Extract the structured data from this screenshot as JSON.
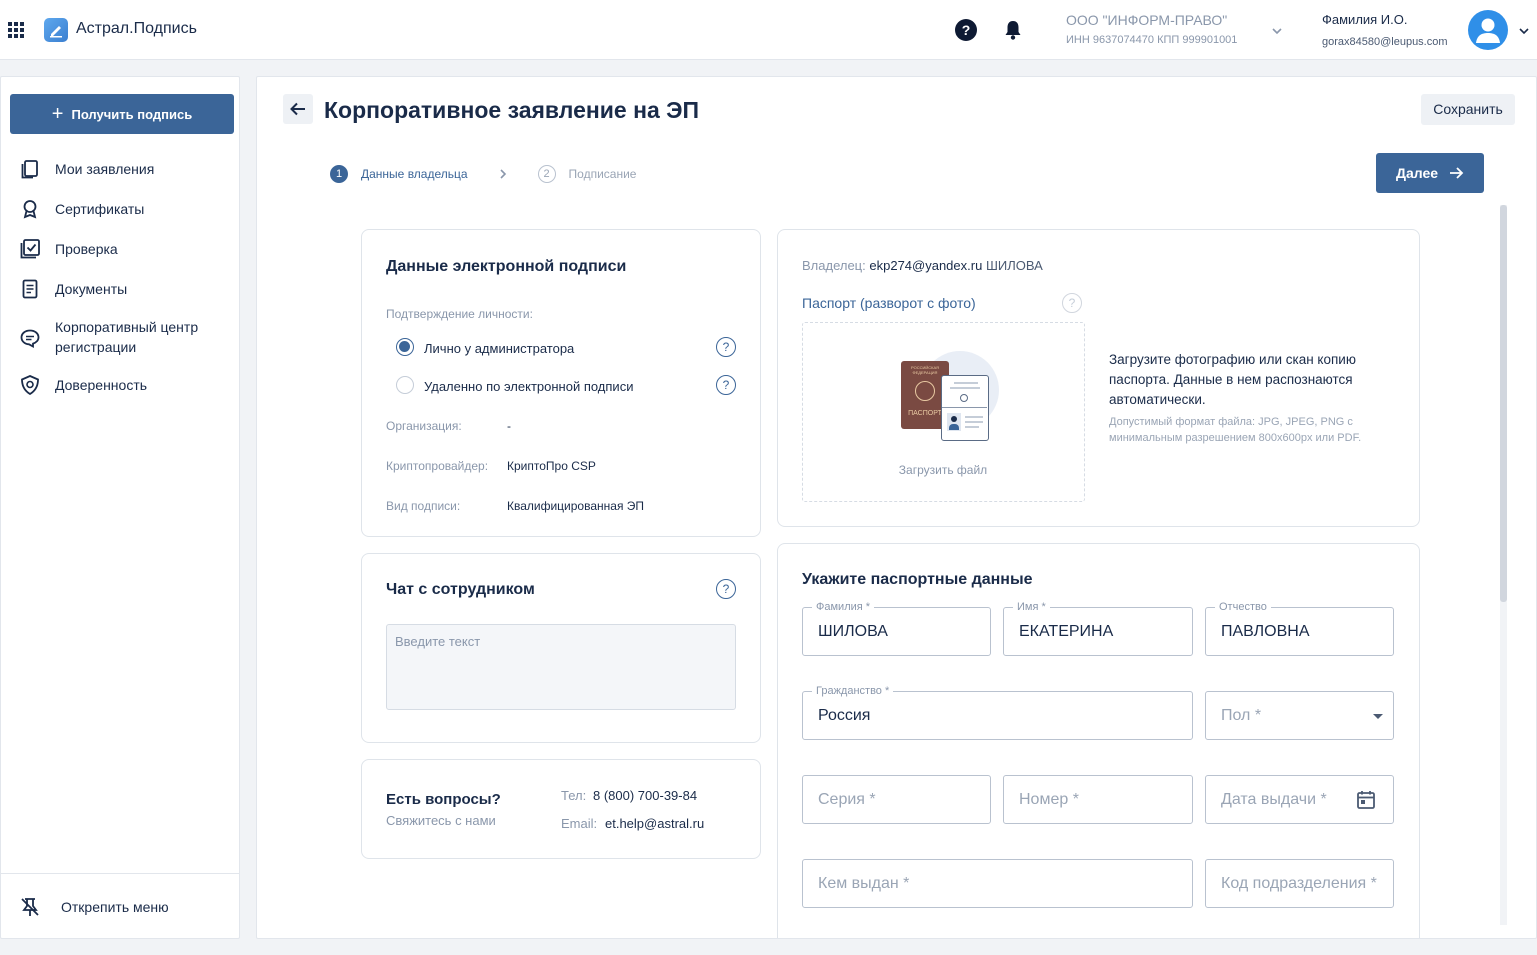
{
  "header": {
    "app_title": "Астрал.Подпись",
    "org_name": "ООО \"ИНФОРМ-ПРАВО\"",
    "org_ids": "ИНН 9637074470   КПП 999901001",
    "user_name": "Фамилия И.О.",
    "user_email": "gorax84580@leupus.com",
    "help_glyph": "?"
  },
  "sidebar": {
    "cta_label": "Получить подпись",
    "items": [
      {
        "label": "Мои заявления",
        "icon": "documents-icon"
      },
      {
        "label": "Сертификаты",
        "icon": "award-icon"
      },
      {
        "label": "Проверка",
        "icon": "check-square-icon"
      },
      {
        "label": "Документы",
        "icon": "file-lines-icon"
      },
      {
        "label": "Корпоративный центр регистрации",
        "icon": "chat-icon"
      },
      {
        "label": "Доверенность",
        "icon": "shield-badge-icon"
      }
    ],
    "unpin_label": "Открепить меню"
  },
  "main": {
    "title": "Корпоративное заявление на ЭП",
    "save_label": "Сохранить",
    "next_label": "Далее",
    "steps": [
      {
        "num": "1",
        "label": "Данные владельца",
        "active": true
      },
      {
        "num": "2",
        "label": "Подписание",
        "active": false
      }
    ]
  },
  "signature_card": {
    "title": "Данные электронной подписи",
    "identity_label": "Подтверждение личности:",
    "options": [
      {
        "label": "Лично у администратора",
        "selected": true
      },
      {
        "label": "Удаленно по электронной подписи",
        "selected": false
      }
    ],
    "rows": [
      {
        "label": "Организация:",
        "value": "-"
      },
      {
        "label": "Криптопровайдер:",
        "value": "КриптоПро CSP"
      },
      {
        "label": "Вид подписи:",
        "value": "Квалифицированная ЭП"
      }
    ]
  },
  "chat_card": {
    "title": "Чат с сотрудником",
    "placeholder": "Введите текст"
  },
  "questions_card": {
    "title": "Есть вопросы?",
    "subtitle": "Свяжитесь с нами",
    "phone_label": "Тел:",
    "phone": "8 (800) 700-39-84",
    "email_label": "Email:",
    "email": "et.help@astral.ru"
  },
  "passport_upload": {
    "owner_label": "Владелец:",
    "owner_email": "ekp274@yandex.ru",
    "owner_name": "ШИЛОВА",
    "section_title": "Паспорт (разворот с фото)",
    "upload_label": "Загрузить файл",
    "hint_main": "Загрузите фотографию или скан копию паспорта. Данные в нем распознаются автоматически.",
    "hint_format": "Допустимый формат файла: JPG, JPEG, PNG с минимальным разрешением 800x600px или PDF.",
    "passport_cover_top": "РОССИЙСКАЯ ФЕДЕРАЦИЯ",
    "passport_cover_bottom": "ПАСПОРТ"
  },
  "passport_form": {
    "title": "Укажите паспортные данные",
    "surname": {
      "label": "Фамилия *",
      "value": "ШИЛОВА"
    },
    "name": {
      "label": "Имя *",
      "value": "ЕКАТЕРИНА"
    },
    "patronymic": {
      "label": "Отчество",
      "value": "ПАВЛОВНА"
    },
    "citizenship": {
      "label": "Гражданство *",
      "value": "Россия"
    },
    "sex": {
      "placeholder": "Пол *"
    },
    "series": {
      "placeholder": "Серия *"
    },
    "number": {
      "placeholder": "Номер *"
    },
    "issue_date": {
      "placeholder": "Дата выдачи *"
    },
    "issued_by": {
      "placeholder": "Кем выдан *"
    },
    "division_code": {
      "placeholder": "Код подразделения *"
    }
  }
}
